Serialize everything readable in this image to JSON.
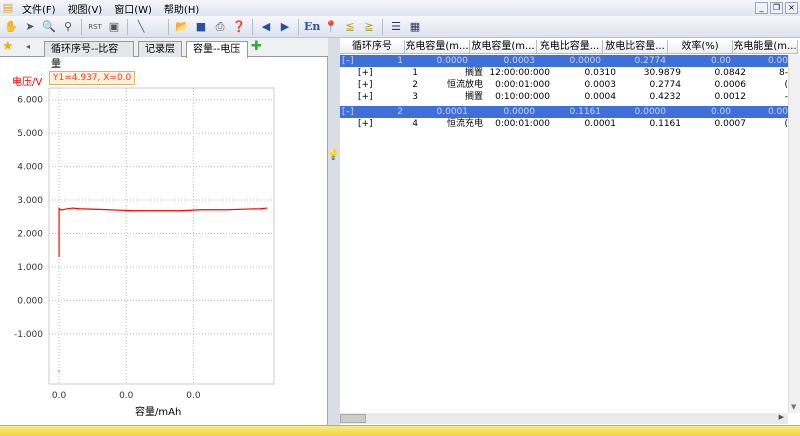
{
  "menu": {
    "items": [
      "文件(F)",
      "视图(V)",
      "窗口(W)",
      "帮助(H)"
    ]
  },
  "window_controls": [
    "_",
    "❐",
    "×"
  ],
  "toolbar": {
    "icons": [
      "hand-icon",
      "pointer-icon",
      "zoom-in-icon",
      "zoom-out-icon",
      "rst-icon",
      "copy-chart-icon",
      "line-icon",
      "open-folder-icon",
      "save-icon",
      "print-icon",
      "help-icon",
      "back-arrow-icon",
      "forward-arrow-icon",
      "en-language-icon",
      "pin-icon",
      "sort-asc-icon",
      "sort-desc-icon",
      "table-view-icon",
      "table-settings-icon"
    ],
    "en_label": "En"
  },
  "left_tabs": {
    "items": [
      "循环序号--比容量",
      "记录层",
      "容量--电压"
    ],
    "active": 2
  },
  "tooltip": "Y1=4.937, X=0.0",
  "chart_data": {
    "type": "line",
    "ylabel": "电压/V",
    "xlabel": "容量/mAh",
    "ylim": [
      -2.5,
      6.35
    ],
    "xlim": [
      -1.5e-05,
      0.00032
    ],
    "yticks": [
      6,
      5,
      4,
      3,
      2,
      1,
      0,
      -1
    ],
    "ytick_labels": [
      "6.000",
      "5.000",
      "4.000",
      "3.000",
      "2.000",
      "1.000",
      "0.000",
      "-1.000"
    ],
    "xticks": [
      0,
      0.0001,
      0.0002
    ],
    "xtick_labels": [
      "0.0",
      "0.0",
      "0.0"
    ],
    "grid": true,
    "series": [
      {
        "color": "#ff0000",
        "x": [
          0,
          0,
          3e-06,
          1e-05,
          2e-05,
          3e-05,
          6e-05,
          0.00011,
          0.00018,
          0.00021,
          0.00025,
          0.00028,
          0.0003,
          0.00031
        ],
        "y": [
          1.3,
          2.75,
          2.7,
          2.73,
          2.76,
          2.74,
          2.72,
          2.68,
          2.68,
          2.71,
          2.71,
          2.73,
          2.74,
          2.76
        ]
      },
      {
        "color": "#ff6666",
        "x": [
          0
        ],
        "y": [
          -2.1
        ]
      }
    ]
  },
  "grid": {
    "columns": [
      "循环序号",
      "充电容量(m...",
      "放电容量(m...",
      "充电比容量...",
      "放电比容量...",
      "效率(%)",
      "充电能量(m..."
    ],
    "rows": [
      {
        "type": "group",
        "toggle": "[–]",
        "cells": [
          "1",
          "0.0000",
          "0.0003",
          "0.0000",
          "0.2774",
          "0.00",
          "0.00"
        ]
      },
      {
        "type": "child",
        "toggle": "[+]",
        "cells": [
          "1",
          "搁置",
          "12:00:00:000",
          "0.0310",
          "30.9879",
          "0.0842",
          "8-"
        ]
      },
      {
        "type": "child",
        "toggle": "[+]",
        "cells": [
          "2",
          "恒流放电",
          "0:00:01:000",
          "0.0003",
          "0.2774",
          "0.0006",
          "("
        ]
      },
      {
        "type": "child",
        "toggle": "[+]",
        "cells": [
          "3",
          "搁置",
          "0:10:00:000",
          "0.0004",
          "0.4232",
          "0.0012",
          "-"
        ]
      },
      {
        "type": "group",
        "toggle": "[–]",
        "cells": [
          "2",
          "0.0001",
          "0.0000",
          "0.1161",
          "0.0000",
          "0.00",
          "0.00"
        ]
      },
      {
        "type": "child",
        "toggle": "[+]",
        "cells": [
          "4",
          "恒流充电",
          "0:00:01:000",
          "0.0001",
          "0.1161",
          "0.0007",
          "("
        ]
      }
    ]
  },
  "colors": {
    "selection": "#3f6fd8",
    "series": "#ff0000",
    "status_bar": "#f4dc5a"
  }
}
